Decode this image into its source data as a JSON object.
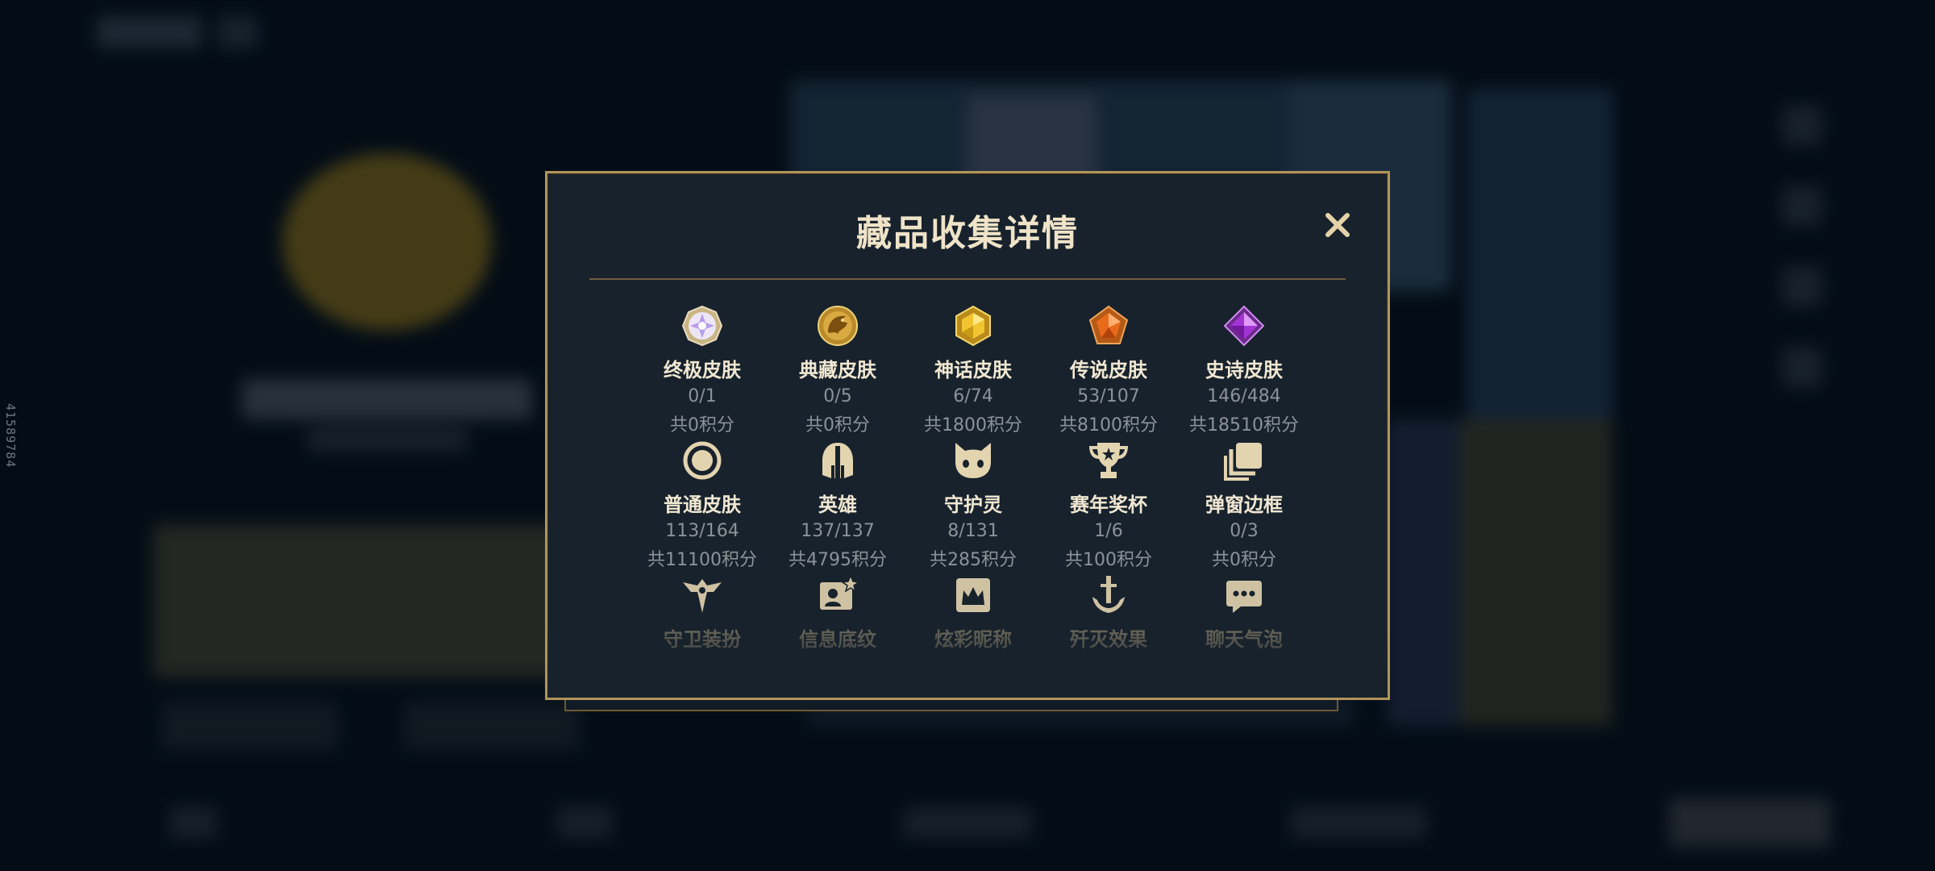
{
  "side_id": "41589784",
  "modal": {
    "title": "藏品收集详情",
    "close_label": "✕"
  },
  "categories": [
    {
      "label": "终极皮肤",
      "count": "0/1",
      "points": "共0积分",
      "icon": "ultimate-gem-icon"
    },
    {
      "label": "典藏皮肤",
      "count": "0/5",
      "points": "共0积分",
      "icon": "dragon-emblem-icon"
    },
    {
      "label": "神话皮肤",
      "count": "6/74",
      "points": "共1800积分",
      "icon": "mythic-gem-icon"
    },
    {
      "label": "传说皮肤",
      "count": "53/107",
      "points": "共8100积分",
      "icon": "legendary-gem-icon"
    },
    {
      "label": "史诗皮肤",
      "count": "146/484",
      "points": "共18510积分",
      "icon": "epic-gem-icon"
    },
    {
      "label": "普通皮肤",
      "count": "113/164",
      "points": "共11100积分",
      "icon": "ring-icon"
    },
    {
      "label": "英雄",
      "count": "137/137",
      "points": "共4795积分",
      "icon": "helmet-icon"
    },
    {
      "label": "守护灵",
      "count": "8/131",
      "points": "共285积分",
      "icon": "pet-face-icon"
    },
    {
      "label": "赛年奖杯",
      "count": "1/6",
      "points": "共100积分",
      "icon": "trophy-icon"
    },
    {
      "label": "弹窗边框",
      "count": "0/3",
      "points": "共0积分",
      "icon": "frame-stack-icon"
    },
    {
      "label": "守卫装扮",
      "icon": "ward-icon"
    },
    {
      "label": "信息底纹",
      "icon": "profile-card-icon"
    },
    {
      "label": "炫彩昵称",
      "icon": "crown-badge-icon"
    },
    {
      "label": "歼灭效果",
      "icon": "anchor-sword-icon"
    },
    {
      "label": "聊天气泡",
      "icon": "chat-bubble-icon"
    }
  ],
  "colors": {
    "gold": "#b1945a",
    "panel": "#17222c",
    "text": "#f1e7d2",
    "muted": "#8c9298",
    "icon_gold": "#d9c49a"
  }
}
